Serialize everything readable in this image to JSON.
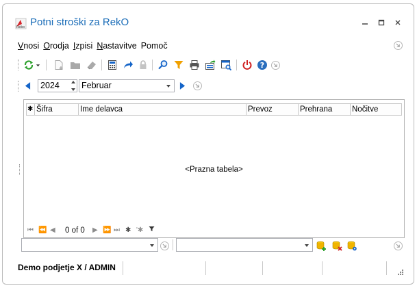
{
  "window": {
    "title": "Potni stroški za RekO"
  },
  "menu": [
    {
      "accel": "V",
      "rest": "nosi"
    },
    {
      "accel": "O",
      "rest": "rodja"
    },
    {
      "accel": "I",
      "rest": "zpisi"
    },
    {
      "accel": "N",
      "rest": "astavitve"
    },
    {
      "accel": "",
      "rest": "Pomoč"
    }
  ],
  "toolbar": {
    "icons": [
      "refresh-icon",
      "new-icon",
      "folder-icon",
      "eraser-icon",
      "calculator-icon",
      "forward-icon",
      "lock-icon",
      "search-icon",
      "filter-icon",
      "print-icon",
      "export-icon",
      "preview-icon",
      "power-icon",
      "help-icon"
    ]
  },
  "period": {
    "year": "2024",
    "month": "Februar"
  },
  "grid": {
    "columns": [
      "Šifra",
      "Ime delavca",
      "Prevoz",
      "Prehrana",
      "Nočitve"
    ],
    "empty_text": "<Prazna tabela>",
    "navigator_count": "0 of 0"
  },
  "statusbar": {
    "user": "Demo podjetje X / ADMIN"
  },
  "colors": {
    "title": "#1b6db8",
    "accent_blue": "#1464c8",
    "refresh_green": "#2ca02c",
    "filter_orange": "#f0a000",
    "power_red": "#d02020"
  }
}
